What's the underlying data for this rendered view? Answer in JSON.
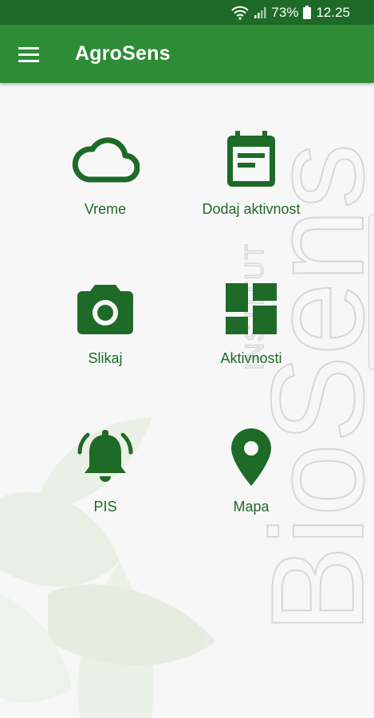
{
  "status_bar": {
    "battery": "73%",
    "time": "12.25"
  },
  "app_bar": {
    "title": "AgroSens"
  },
  "tiles": [
    {
      "label": "Vreme",
      "icon": "cloud-icon"
    },
    {
      "label": "Dodaj aktivnost",
      "icon": "calendar-note-icon"
    },
    {
      "label": "Slikaj",
      "icon": "camera-icon"
    },
    {
      "label": "Aktivnosti",
      "icon": "dashboard-grid-icon"
    },
    {
      "label": "PIS",
      "icon": "bell-ringing-icon"
    },
    {
      "label": "Mapa",
      "icon": "map-pin-icon"
    }
  ],
  "watermark": {
    "brand": "BioSens",
    "sub": "INSTITUT"
  },
  "colors": {
    "accent": "#2e8b36",
    "dark_accent": "#1e6a27",
    "background": "#f7f7f7"
  }
}
